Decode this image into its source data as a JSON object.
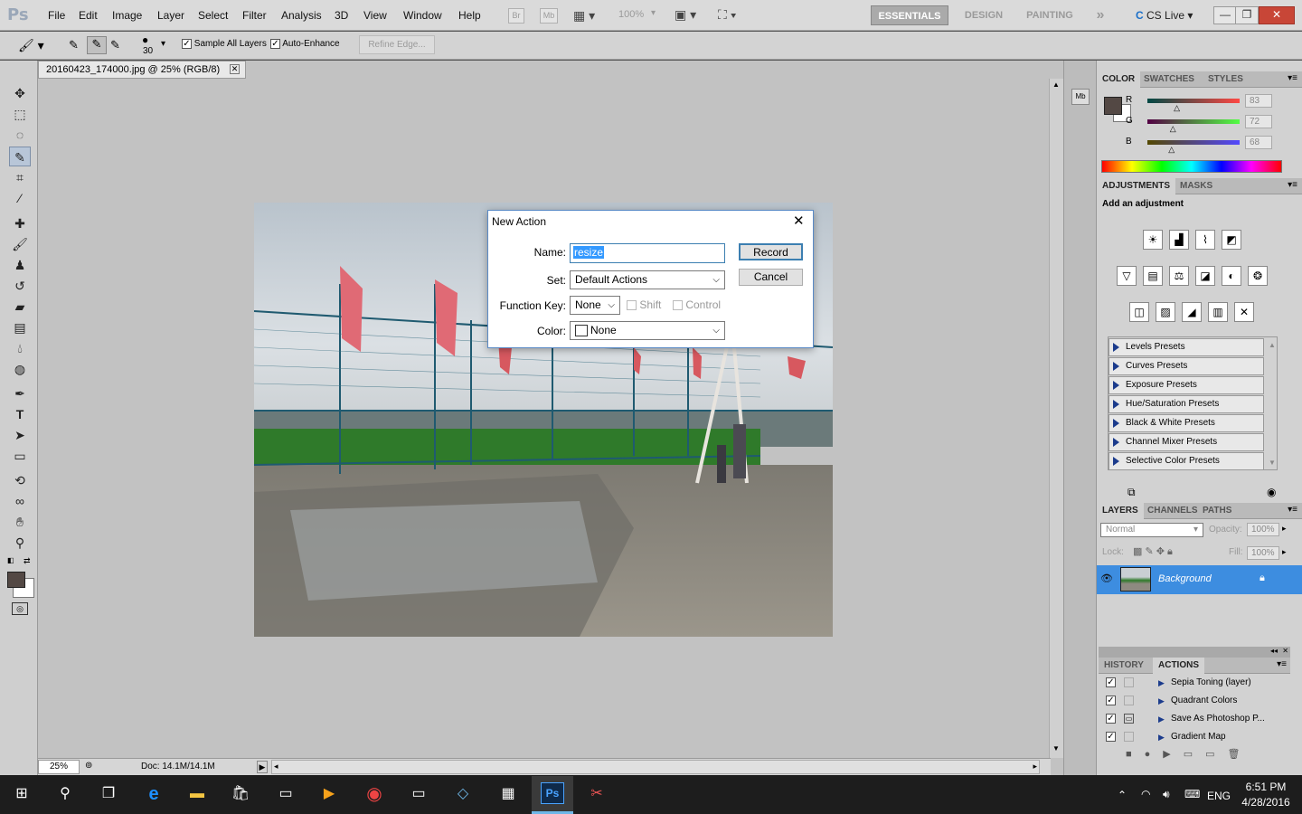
{
  "app": {
    "logo": "Ps"
  },
  "menu": [
    "File",
    "Edit",
    "Image",
    "Layer",
    "Select",
    "Filter",
    "Analysis",
    "3D",
    "View",
    "Window",
    "Help"
  ],
  "menubar_tools": {
    "bridge": "Br",
    "minibridge": "Mb",
    "zoom": "100%"
  },
  "workspaces": {
    "essentials": "ESSENTIALS",
    "design": "DESIGN",
    "painting": "PAINTING",
    "more": "»",
    "cslive": "CS Live"
  },
  "options_bar": {
    "brush_size": "30",
    "sample_all_layers": "Sample All Layers",
    "auto_enhance": "Auto-Enhance",
    "refine_edge": "Refine Edge..."
  },
  "document": {
    "tab_title": "20160423_174000.jpg @ 25% (RGB/8)",
    "zoom": "25%",
    "doc_size": "Doc: 14.1M/14.1M"
  },
  "color_panel": {
    "tabs": [
      "COLOR",
      "SWATCHES",
      "STYLES"
    ],
    "r_label": "R",
    "g_label": "G",
    "b_label": "B",
    "r": "83",
    "g": "72",
    "b": "68",
    "r_frac": 0.325,
    "g_frac": 0.282,
    "b_frac": 0.267,
    "foreground": "#534844",
    "background": "#ffffff"
  },
  "adjustments_panel": {
    "tabs": [
      "ADJUSTMENTS",
      "MASKS"
    ],
    "heading": "Add an adjustment",
    "presets": [
      "Levels Presets",
      "Curves Presets",
      "Exposure Presets",
      "Hue/Saturation Presets",
      "Black & White Presets",
      "Channel Mixer Presets",
      "Selective Color Presets"
    ]
  },
  "layers_panel": {
    "tabs": [
      "LAYERS",
      "CHANNELS",
      "PATHS"
    ],
    "blend_mode": "Normal",
    "opacity_label": "Opacity:",
    "opacity": "100%",
    "lock_label": "Lock:",
    "fill_label": "Fill:",
    "fill": "100%",
    "layer_name": "Background"
  },
  "actions_panel": {
    "tabs": [
      "HISTORY",
      "ACTIONS"
    ],
    "items": [
      "Sepia Toning (layer)",
      "Quadrant Colors",
      "Save As Photoshop P...",
      "Gradient Map"
    ]
  },
  "dialog": {
    "title": "New Action",
    "name_label": "Name:",
    "name_value": "resize",
    "set_label": "Set:",
    "set_value": "Default Actions",
    "fkey_label": "Function Key:",
    "fkey_value": "None",
    "shift_label": "Shift",
    "control_label": "Control",
    "color_label": "Color:",
    "color_value": "None",
    "record": "Record",
    "cancel": "Cancel"
  },
  "taskbar": {
    "time": "6:51 PM",
    "date": "4/28/2016",
    "lang": "ENG"
  }
}
